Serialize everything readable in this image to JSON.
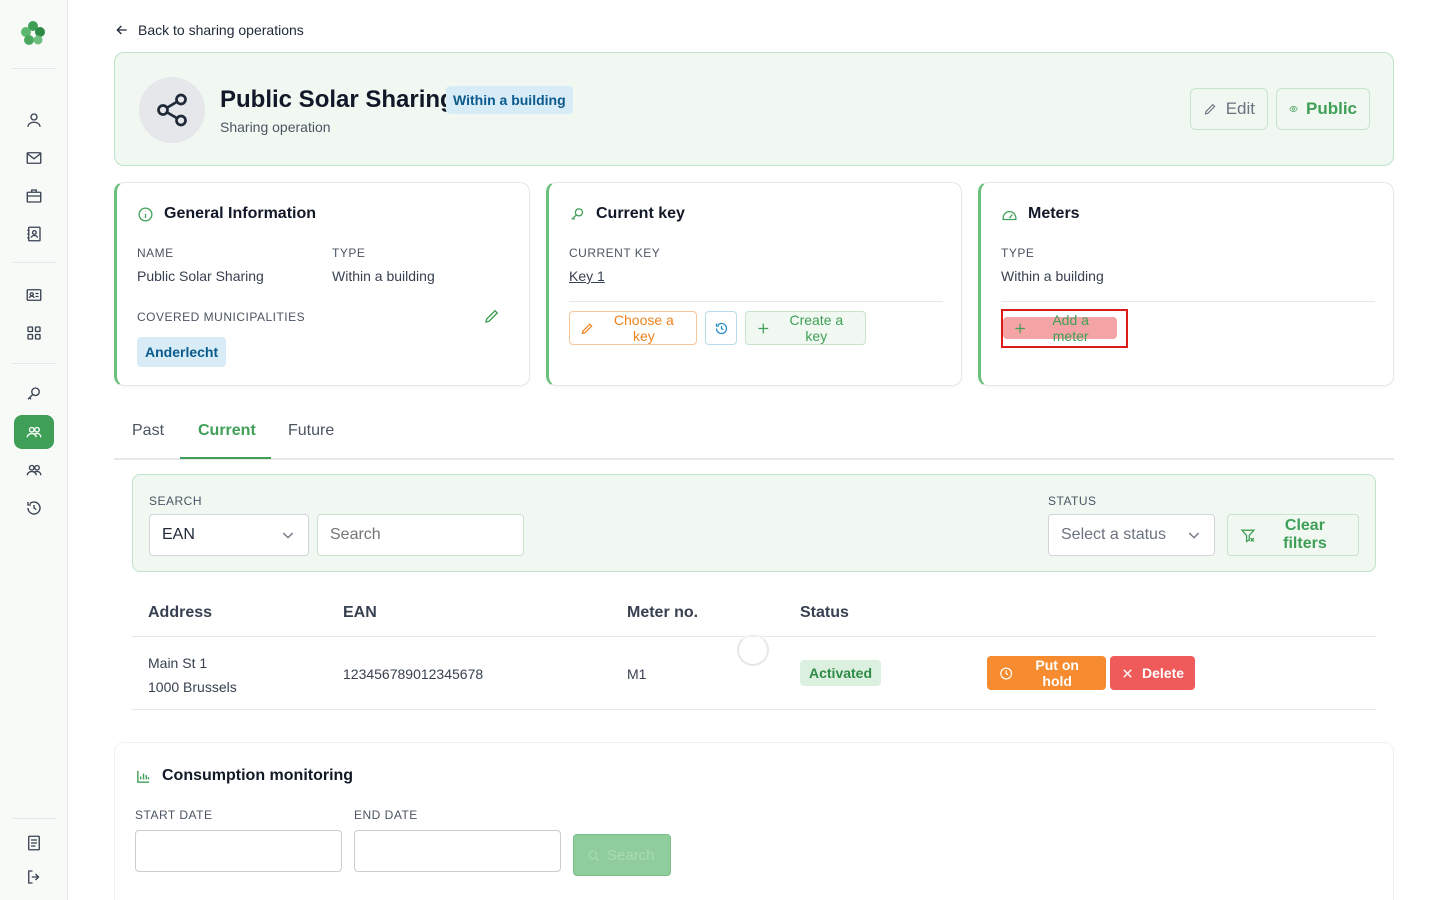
{
  "nav": {
    "back_label": "Back to sharing operations"
  },
  "header": {
    "title": "Public Solar Sharing",
    "badge": "Within a building",
    "subtitle": "Sharing operation",
    "edit_label": "Edit",
    "public_label": "Public"
  },
  "general": {
    "title": "General Information",
    "name_label": "NAME",
    "name_value": "Public Solar Sharing",
    "type_label": "TYPE",
    "type_value": "Within a building",
    "muni_label": "COVERED MUNICIPALITIES",
    "muni_value": "Anderlecht"
  },
  "key": {
    "title": "Current key",
    "current_label": "CURRENT KEY",
    "current_value": "Key 1",
    "choose_label": "Choose a key",
    "create_label": "Create a key"
  },
  "meters": {
    "title": "Meters",
    "type_label": "TYPE",
    "type_value": "Within a building",
    "add_label": "Add a meter"
  },
  "tabs": [
    "Past",
    "Current",
    "Future"
  ],
  "filters": {
    "search_label": "SEARCH",
    "field_value": "EAN",
    "search_placeholder": "Search",
    "status_label": "STATUS",
    "status_placeholder": "Select a status",
    "clear_label": "Clear filters"
  },
  "table": {
    "headers": [
      "Address",
      "EAN",
      "Meter no.",
      "Status"
    ],
    "rows": [
      {
        "address_line1": "Main St 1",
        "address_line2": "1000 Brussels",
        "ean": "123456789012345678",
        "meter_no": "M1",
        "status": "Activated",
        "hold_label": "Put on hold",
        "delete_label": "Delete"
      }
    ]
  },
  "consumption": {
    "title": "Consumption monitoring",
    "start_label": "START DATE",
    "end_label": "END DATE",
    "search_label": "Search"
  },
  "colors": {
    "accent": "#3f9f57",
    "orange": "#f68b2f",
    "danger": "#ef5a5a",
    "info": "#0b5a8c"
  }
}
